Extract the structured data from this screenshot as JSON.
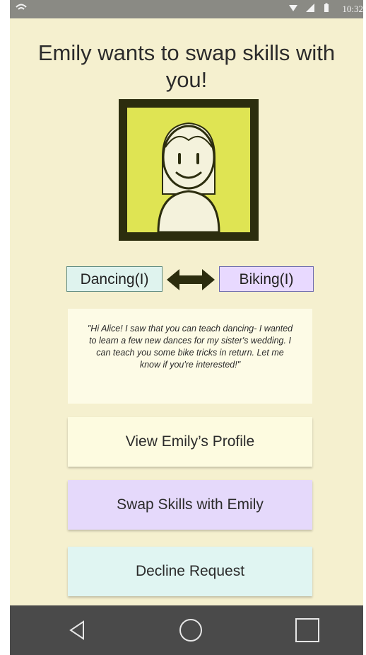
{
  "status_bar": {
    "time": "10:32",
    "icons": [
      "wifi-icon",
      "signal-icon",
      "battery-icon"
    ]
  },
  "header": {
    "title": "Emily wants to swap skills with you!"
  },
  "avatar": {
    "icon": "girl-avatar-icon",
    "frame_color": "#2c2d0e",
    "background_color": "#dfe453"
  },
  "skills": {
    "offered": "Dancing(I)",
    "requested": "Biking(I)",
    "swap_icon": "double-arrow-icon"
  },
  "message": {
    "text": "\"Hi Alice! I saw that you can teach dancing- I wanted to learn a few new dances for my sister's wedding. I can teach you some bike tricks in return. Let me know if you're interested!\""
  },
  "actions": {
    "view_profile": "View Emily’s Profile",
    "swap": "Swap Skills with Emily",
    "decline": "Decline Request"
  },
  "nav_bar": {
    "icons": [
      "back-icon",
      "home-icon",
      "recents-icon"
    ]
  },
  "colors": {
    "screen_background": "#f5f0cf",
    "swap_button": "#e5d9fb",
    "decline_button": "#e0f5f2",
    "profile_button": "#fdfbe0"
  }
}
